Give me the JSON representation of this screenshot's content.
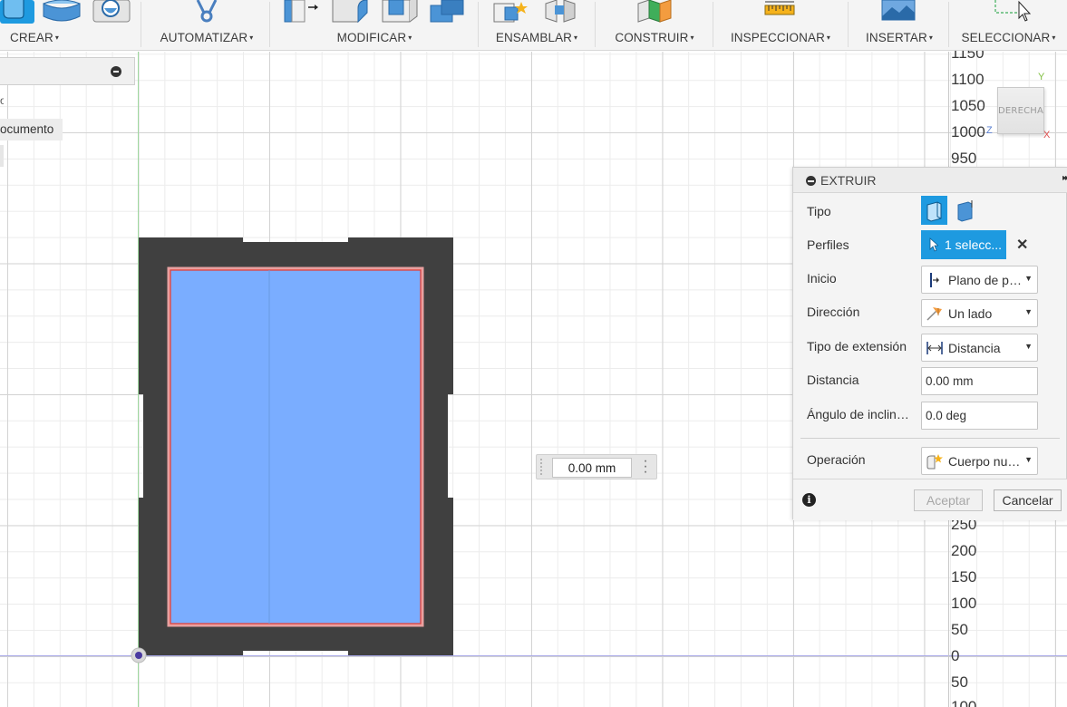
{
  "toolbar": {
    "groups": [
      {
        "label": "CREAR"
      },
      {
        "label": "AUTOMATIZAR"
      },
      {
        "label": "MODIFICAR"
      },
      {
        "label": "ENSAMBLAR"
      },
      {
        "label": "CONSTRUIR"
      },
      {
        "label": "INSPECCIONAR"
      },
      {
        "label": "INSERTAR"
      },
      {
        "label": "SELECCIONAR"
      }
    ],
    "caret": "▾"
  },
  "browser": {
    "item1_partial": "o",
    "document_label": "ocumento"
  },
  "viewcube": {
    "face_label": "DERECHA",
    "axis_y": "Y",
    "axis_x": "X",
    "axis_z": "Z"
  },
  "ruler": {
    "top": [
      "1150",
      "1100",
      "1050",
      "1000",
      "950"
    ],
    "bottom": [
      "250",
      "200",
      "150",
      "100",
      "50",
      "0",
      "50",
      "100"
    ]
  },
  "dimension_input": {
    "value": "0.00 mm"
  },
  "extrude_panel": {
    "title": "EXTRUIR",
    "rows": {
      "tipo": {
        "label": "Tipo"
      },
      "perfiles": {
        "label": "Perfiles",
        "selection": "1 selecc..."
      },
      "inicio": {
        "label": "Inicio",
        "value": "Plano de pe..."
      },
      "direccion": {
        "label": "Dirección",
        "value": "Un lado"
      },
      "tipo_extension": {
        "label": "Tipo de extensión",
        "value": "Distancia"
      },
      "distancia": {
        "label": "Distancia",
        "value": "0.00 mm"
      },
      "angulo": {
        "label": "Ángulo de inclinac...",
        "value": "0.0 deg"
      },
      "operacion": {
        "label": "Operación",
        "value": "Cuerpo nue..."
      }
    },
    "accept_label": "Aceptar",
    "cancel_label": "Cancelar",
    "accent_color": "#1e9ae0"
  },
  "colors": {
    "profile_fill": "#7aadff",
    "body_fill": "#404040",
    "profile_outline": "#e0403a"
  }
}
